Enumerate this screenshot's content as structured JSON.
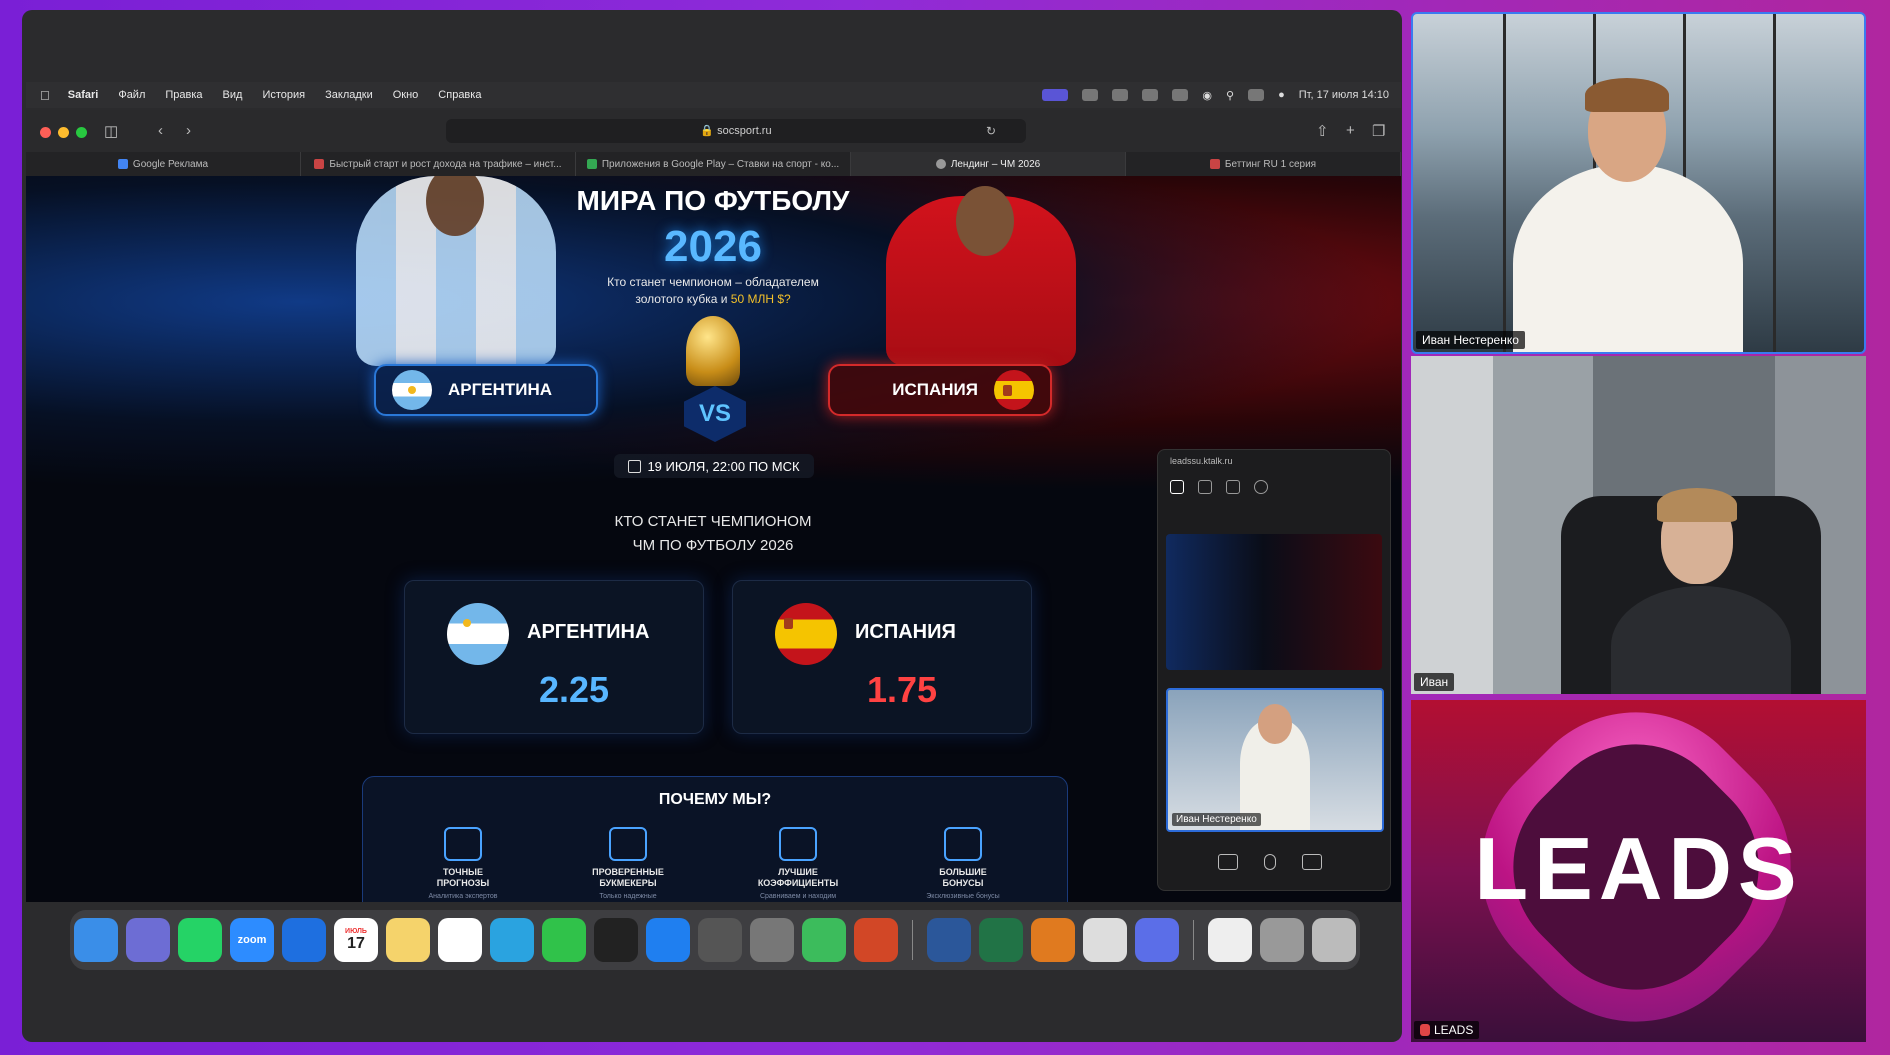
{
  "menubar": {
    "app": "Safari",
    "items": [
      "Файл",
      "Правка",
      "Вид",
      "История",
      "Закладки",
      "Окно",
      "Справка"
    ],
    "clock": "Пт, 17 июля 14:10"
  },
  "browser": {
    "url": "socsport.ru",
    "tabs": [
      {
        "label": "Google Реклама",
        "active": false
      },
      {
        "label": "Быстрый старт и рост дохода на трафике – инст...",
        "active": false
      },
      {
        "label": "Приложения в Google Play – Ставки на спорт - ко...",
        "active": false
      },
      {
        "label": "Лендинг – ЧМ 2026",
        "active": true
      },
      {
        "label": "Беттинг RU 1 серия",
        "active": false
      }
    ]
  },
  "landing": {
    "title": "МИРА ПО ФУТБОЛУ",
    "year": "2026",
    "subtitle_line1": "Кто станет чемпионом – обладателем",
    "subtitle_line2_prefix": "золотого кубка и ",
    "subtitle_highlight": "50 МЛН $?",
    "team_left": "АРГЕНТИНА",
    "team_right": "ИСПАНИЯ",
    "vs": "VS",
    "match_date": "19 ИЮЛЯ, 22:00 ПО МСК",
    "who_line1": "КТО СТАНЕТ ЧЕМПИОНОМ",
    "who_line2": "ЧМ ПО ФУТБОЛУ 2026",
    "odds": [
      {
        "team": "АРГЕНТИНА",
        "value": "2.25"
      },
      {
        "team": "ИСПАНИЯ",
        "value": "1.75"
      }
    ],
    "why_title": "ПОЧЕМУ МЫ?",
    "features": [
      {
        "line1": "ТОЧНЫЕ",
        "line2": "ПРОГНОЗЫ",
        "sub": "Аналитика экспертов"
      },
      {
        "line1": "ПРОВЕРЕННЫЕ",
        "line2": "БУКМЕКЕРЫ",
        "sub": "Только надежные"
      },
      {
        "line1": "ЛУЧШИЕ",
        "line2": "КОЭФФИЦИЕНТЫ",
        "sub": "Сравниваем и находим"
      },
      {
        "line1": "БОЛЬШИЕ",
        "line2": "БОНУСЫ",
        "sub": "Эксклюзивные бонусы"
      }
    ]
  },
  "dock": {
    "calendar_month": "ИЮЛЬ",
    "calendar_day": "17",
    "zoom_label": "zoom"
  },
  "zoom_panel": {
    "url": "leadssu.ktalk.ru",
    "self_name": "Иван Нестеренко"
  },
  "participants": [
    {
      "name": "Иван Нестеренко"
    },
    {
      "name": "Иван"
    },
    {
      "name": "LEADS",
      "logo_text": "LEADS"
    }
  ],
  "colors": {
    "accent_blue": "#58b6ff",
    "accent_red": "#ff4242",
    "highlight_gold": "#f2c02a",
    "active_speaker": "#3a7bf0"
  }
}
